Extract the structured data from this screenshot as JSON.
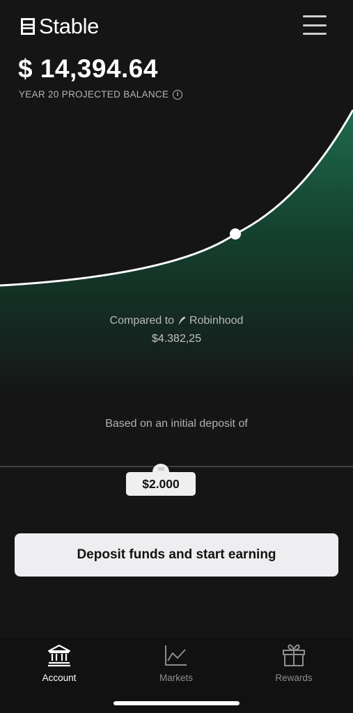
{
  "header": {
    "app_name": "Stable",
    "logo_icon": "stable-logo-icon",
    "menu_icon": "hamburger-menu-icon"
  },
  "balance": {
    "amount": "$ 14,394.64",
    "label": "YEAR 20 PROJECTED BALANCE",
    "info_icon": "info-icon"
  },
  "projection": {
    "series_color": "#ffffff",
    "fill_color": "#1f6b4e",
    "marker_position": 0.64
  },
  "comparison": {
    "prefix": "Compared to",
    "competitor": "Robinhood",
    "competitor_icon": "feather-icon",
    "value": "$4.382,25"
  },
  "deposit": {
    "caption": "Based on an initial deposit of",
    "amount": "$2.000"
  },
  "cta": {
    "label": "Deposit funds and start earning"
  },
  "tabs": [
    {
      "label": "Account",
      "icon": "bank-icon",
      "active": true
    },
    {
      "label": "Markets",
      "icon": "line-chart-icon",
      "active": false
    },
    {
      "label": "Rewards",
      "icon": "gift-icon",
      "active": false
    }
  ]
}
